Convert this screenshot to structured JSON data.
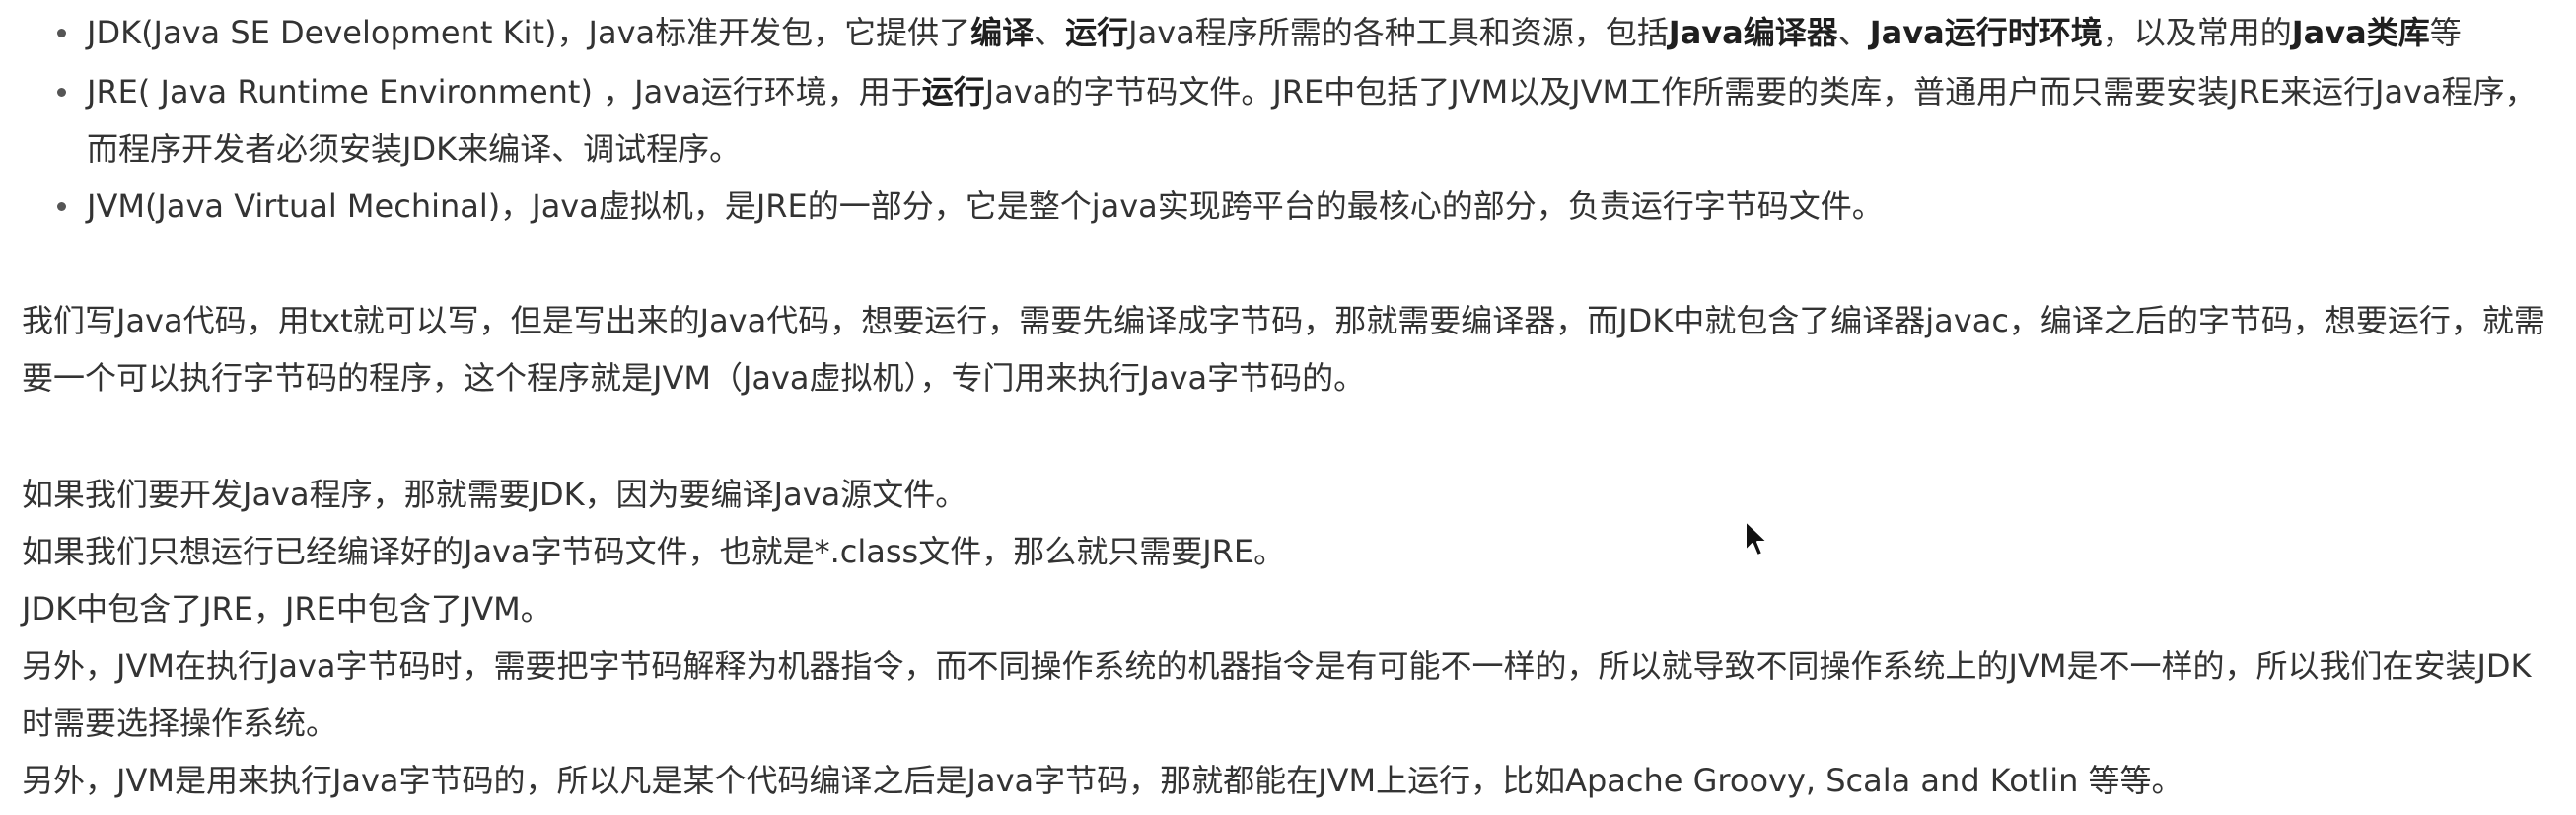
{
  "bullets": [
    {
      "parts": [
        {
          "text": "JDK(Java SE Development Kit)，Java标准开发包，它提供了",
          "bold": false
        },
        {
          "text": "编译",
          "bold": true
        },
        {
          "text": "、",
          "bold": false
        },
        {
          "text": "运行",
          "bold": true
        },
        {
          "text": "Java程序所需的各种工具和资源，包括",
          "bold": false
        },
        {
          "text": "Java编译器",
          "bold": true
        },
        {
          "text": "、",
          "bold": false
        },
        {
          "text": "Java运行时环境",
          "bold": true
        },
        {
          "text": "，以及常用的",
          "bold": false
        },
        {
          "text": "Java类库",
          "bold": true
        },
        {
          "text": "等",
          "bold": false
        }
      ]
    },
    {
      "parts": [
        {
          "text": "JRE( Java Runtime Environment) ，Java运行环境，用于",
          "bold": false
        },
        {
          "text": "运行",
          "bold": true
        },
        {
          "text": "Java的字节码文件。JRE中包括了JVM以及JVM工作所需要的类库，普通用户而只需要安装JRE来运行Java程序，而程序开发者必须安装JDK来编译、调试程序。",
          "bold": false
        }
      ]
    },
    {
      "parts": [
        {
          "text": "JVM(Java Virtual Mechinal)，Java虚拟机，是JRE的一部分，它是整个java实现跨平台的最核心的部分，负责运行字节码文件。",
          "bold": false
        }
      ]
    }
  ],
  "paragraphs": [
    "我们写Java代码，用txt就可以写，但是写出来的Java代码，想要运行，需要先编译成字节码，那就需要编译器，而JDK中就包含了编译器javac，编译之后的字节码，想要运行，就需要一个可以执行字节码的程序，这个程序就是JVM（Java虚拟机），专门用来执行Java字节码的。",
    "如果我们要开发Java程序，那就需要JDK，因为要编译Java源文件。",
    "如果我们只想运行已经编译好的Java字节码文件，也就是*.class文件，那么就只需要JRE。",
    "JDK中包含了JRE，JRE中包含了JVM。",
    "另外，JVM在执行Java字节码时，需要把字节码解释为机器指令，而不同操作系统的机器指令是有可能不一样的，所以就导致不同操作系统上的JVM是不一样的，所以我们在安装JDK时需要选择操作系统。",
    "另外，JVM是用来执行Java字节码的，所以凡是某个代码编译之后是Java字节码，那就都能在JVM上运行，比如Apache Groovy, Scala and Kotlin 等等。"
  ],
  "icons": {
    "cursor": "mouse-pointer-icon"
  }
}
